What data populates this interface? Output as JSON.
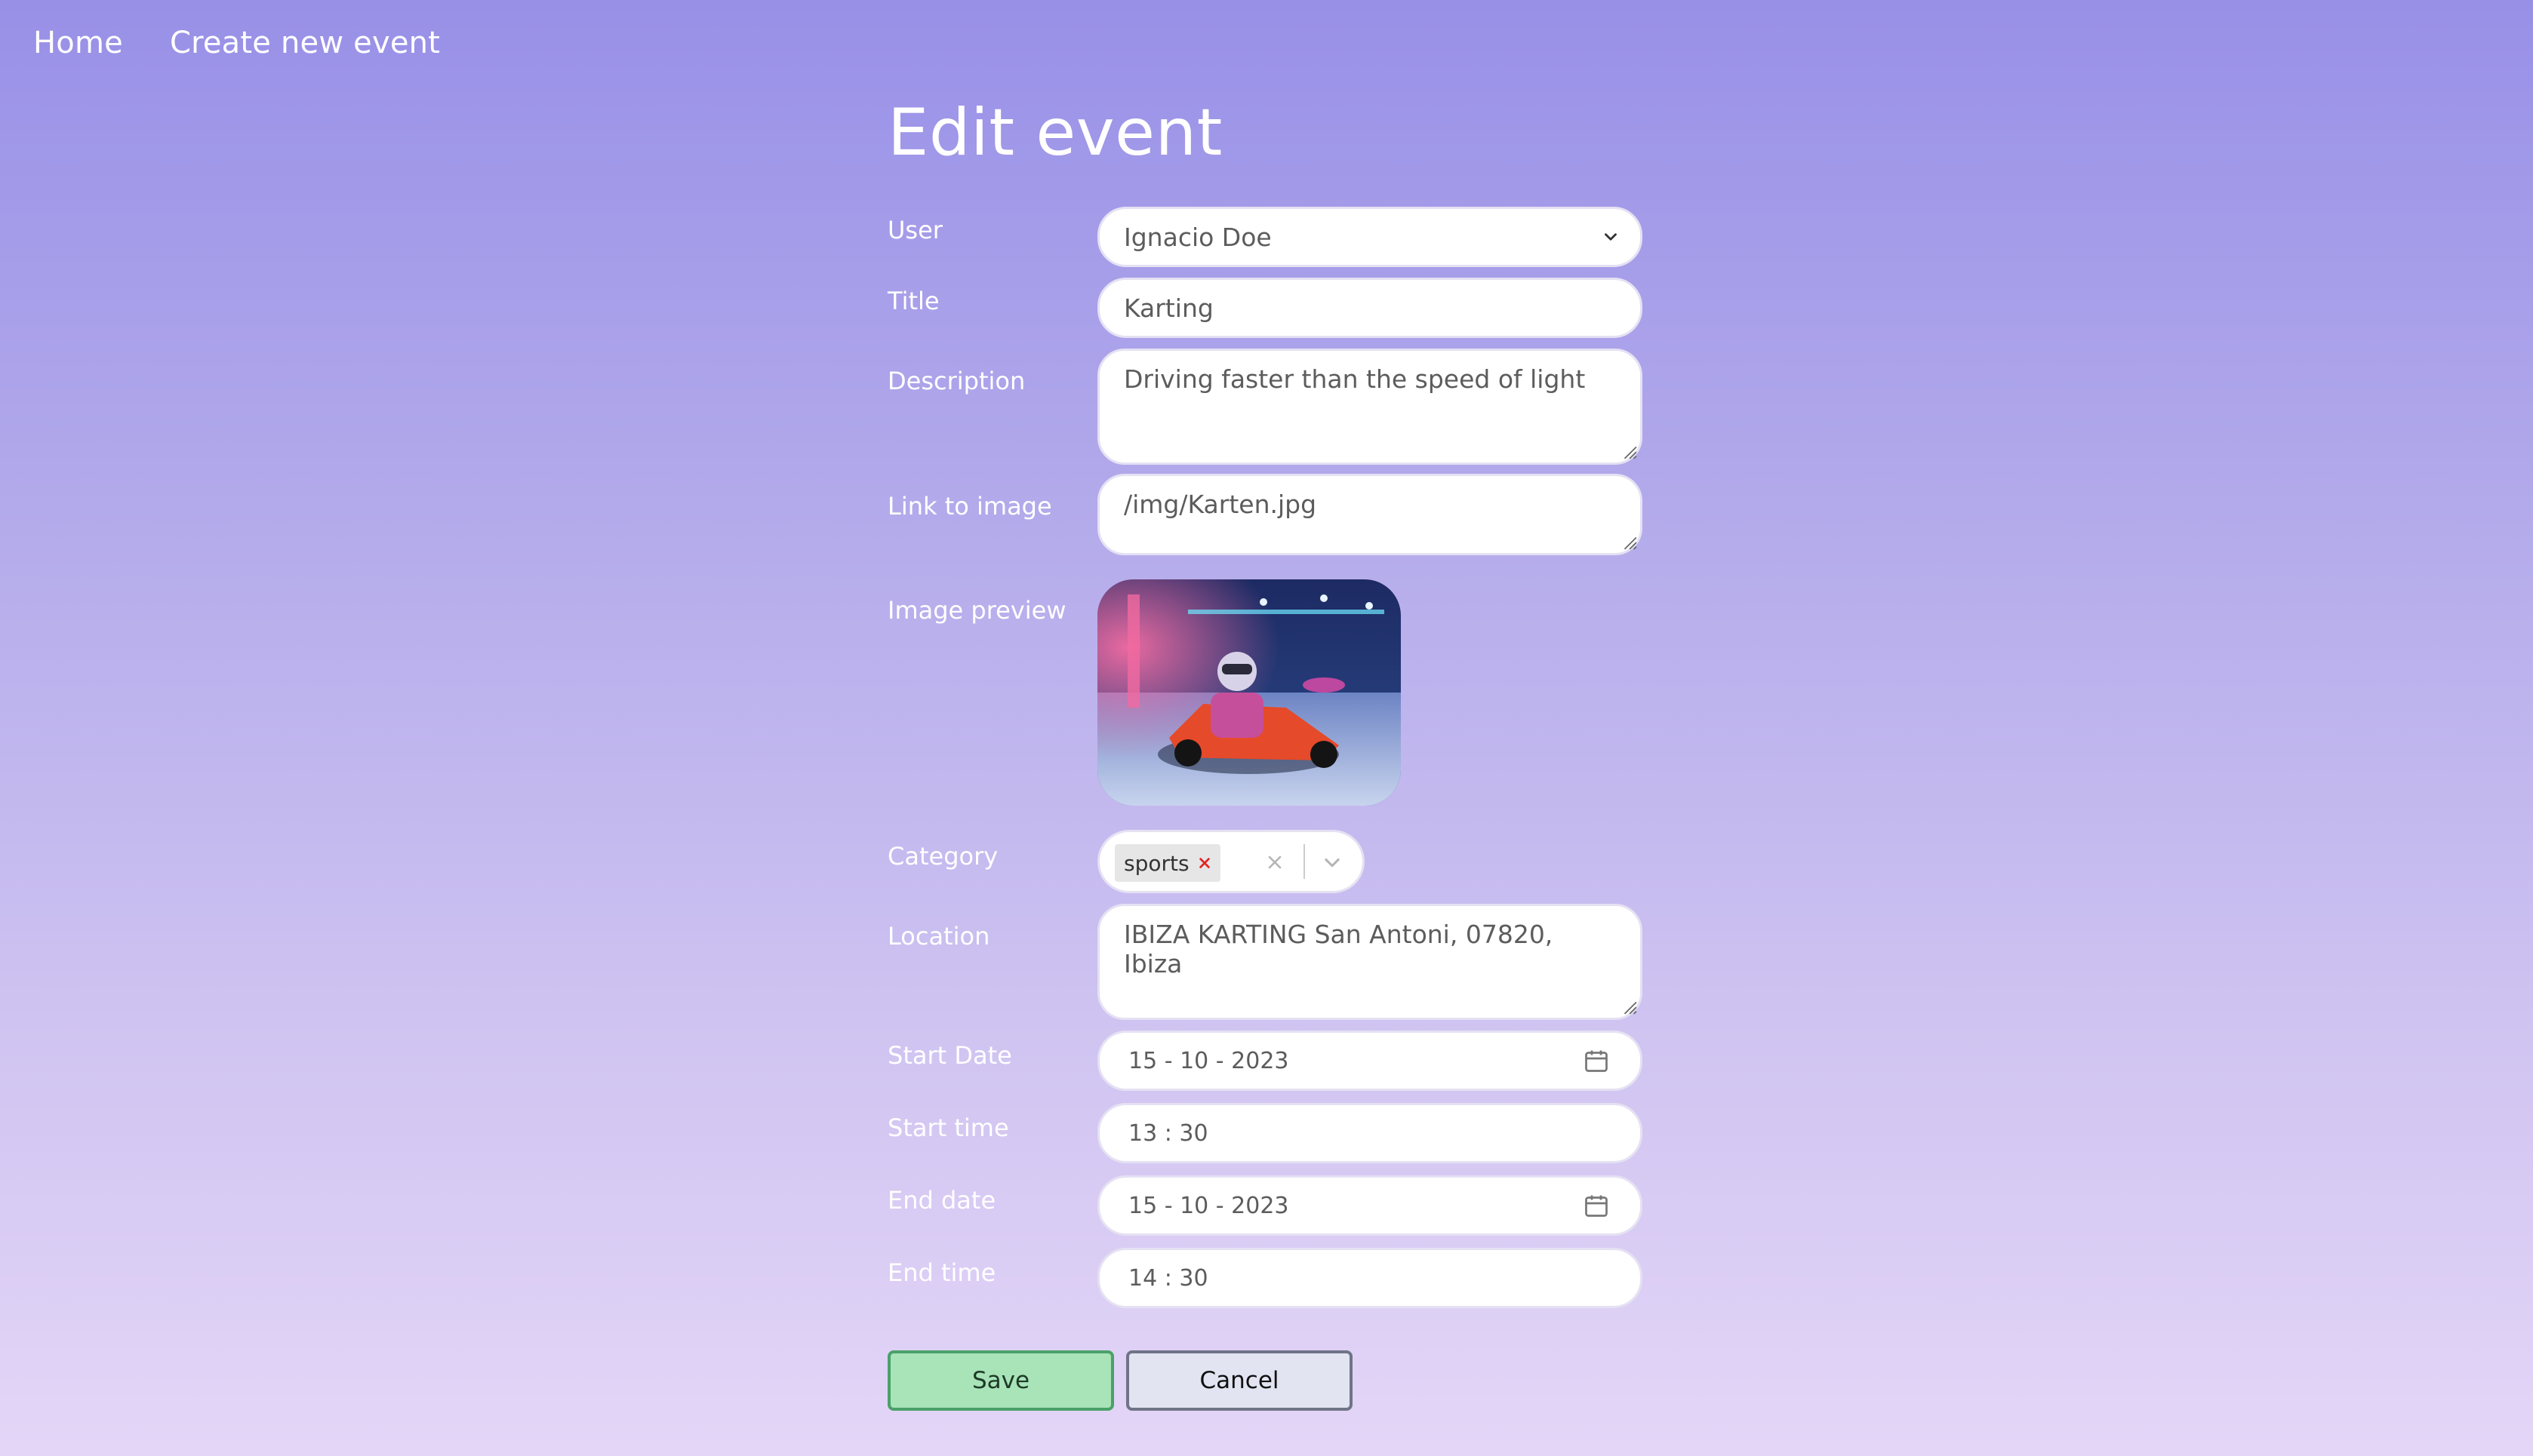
{
  "nav": {
    "home": "Home",
    "create_event": "Create new event"
  },
  "page_title": "Edit event",
  "form": {
    "user": {
      "label": "User",
      "value": "Ignacio Doe"
    },
    "title": {
      "label": "Title",
      "value": "Karting"
    },
    "description": {
      "label": "Description",
      "value": "Driving faster than the speed of light"
    },
    "image_link": {
      "label": "Link to image",
      "value": "/img/Karten.jpg"
    },
    "image_preview": {
      "label": "Image preview"
    },
    "category": {
      "label": "Category",
      "selected": [
        "sports"
      ]
    },
    "location": {
      "label": "Location",
      "value": "IBIZA KARTING San Antoni, 07820, Ibiza"
    },
    "start_date": {
      "label": "Start Date",
      "value": "15 - 10 - 2023"
    },
    "start_time": {
      "label": "Start time",
      "value": "13 : 30"
    },
    "end_date": {
      "label": "End date",
      "value": "15 - 10 - 2023"
    },
    "end_time": {
      "label": "End time",
      "value": "14 : 30"
    }
  },
  "buttons": {
    "save": "Save",
    "cancel": "Cancel"
  },
  "colors": {
    "bg_top": "#9890e7",
    "bg_bottom": "#e4d6f7",
    "save_bg": "#a9e3b8",
    "save_border": "#4aa169",
    "cancel_bg": "#e2e5f1",
    "cancel_border": "#6f7486",
    "chip_remove": "#e02424"
  },
  "icons": {
    "user_select": "chevron-down-icon",
    "date": "calendar-icon",
    "chip_remove": "close-icon",
    "clear": "clear-icon"
  }
}
